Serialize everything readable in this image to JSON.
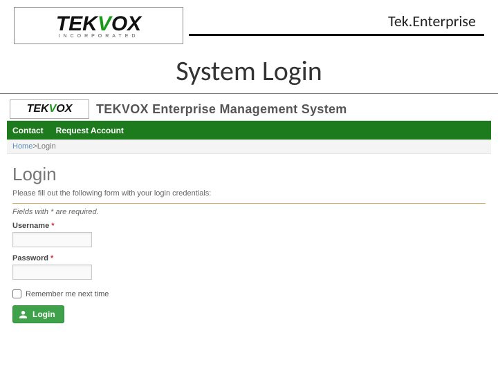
{
  "slide": {
    "product_name": "Tek.Enterprise",
    "logo_main": "TEKVOX",
    "logo_sub": "INCORPORATED",
    "title": "System Login"
  },
  "app": {
    "logo_text": "TEKVOX",
    "title": "TEKVOX Enterprise Management System",
    "nav": {
      "contact": "Contact",
      "request_account": "Request Account"
    },
    "breadcrumb": {
      "home": "Home",
      "sep": ">",
      "current": "Login"
    },
    "login": {
      "heading": "Login",
      "instruction": "Please fill out the following form with your login credentials:",
      "required_note": "Fields with * are required.",
      "username_label": "Username",
      "password_label": "Password",
      "star": "*",
      "username_value": "",
      "password_value": "",
      "remember_label": "Remember me next time",
      "button_label": "Login"
    }
  },
  "colors": {
    "nav_bg": "#1d7a1d",
    "btn_bg": "#3fa24a",
    "accent_green": "#1a9a1a"
  }
}
